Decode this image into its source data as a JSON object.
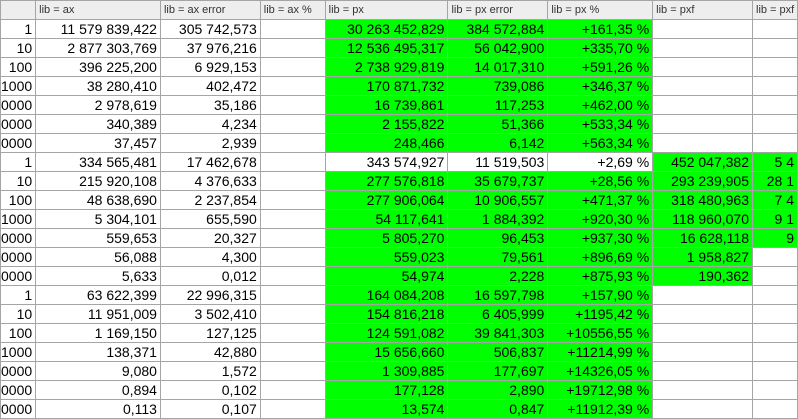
{
  "colors": {
    "highlight": "#00ff00",
    "grid_line": "#a5a5a5",
    "header_bg": "#eeeeee"
  },
  "columns": [
    "",
    "lib = ax",
    "lib = ax error",
    "lib = ax %",
    "lib = px",
    "lib = px error",
    "lib = px %",
    "lib = pxf",
    "lib = pxf"
  ],
  "rows": [
    {
      "cells": [
        "1",
        "11 579 839,422",
        "305 742,573",
        "",
        "30 263 452,829",
        "384 572,884",
        "+161,35 %",
        "",
        ""
      ],
      "green": [
        4,
        5,
        6
      ]
    },
    {
      "cells": [
        "10",
        "2 877 303,769",
        "37 976,216",
        "",
        "12 536 495,317",
        "56 042,900",
        "+335,70 %",
        "",
        ""
      ],
      "green": [
        4,
        5,
        6
      ]
    },
    {
      "cells": [
        "100",
        "396 225,200",
        "6 929,153",
        "",
        "2 738 929,819",
        "14 017,310",
        "+591,26 %",
        "",
        ""
      ],
      "green": [
        4,
        5,
        6
      ]
    },
    {
      "cells": [
        "1000",
        "38 280,410",
        "402,472",
        "",
        "170 871,732",
        "739,086",
        "+346,37 %",
        "",
        ""
      ],
      "green": [
        4,
        5,
        6
      ]
    },
    {
      "cells": [
        "0000",
        "2 978,619",
        "35,186",
        "",
        "16 739,861",
        "117,253",
        "+462,00 %",
        "",
        ""
      ],
      "green": [
        4,
        5,
        6
      ]
    },
    {
      "cells": [
        "0000",
        "340,389",
        "4,234",
        "",
        "2 155,822",
        "51,366",
        "+533,34 %",
        "",
        ""
      ],
      "green": [
        4,
        5,
        6
      ]
    },
    {
      "cells": [
        "0000",
        "37,457",
        "2,939",
        "",
        "248,466",
        "6,142",
        "+563,34 %",
        "",
        ""
      ],
      "green": [
        4,
        5,
        6
      ]
    },
    {
      "cells": [
        "1",
        "334 565,481",
        "17 462,678",
        "",
        "343 574,927",
        "11 519,503",
        "+2,69 %",
        "452 047,382",
        "5 4"
      ],
      "green": [
        7,
        8
      ]
    },
    {
      "cells": [
        "10",
        "215 920,108",
        "4 376,633",
        "",
        "277 576,818",
        "35 679,737",
        "+28,56 %",
        "293 239,905",
        "28 1"
      ],
      "green": [
        4,
        5,
        6,
        7,
        8
      ]
    },
    {
      "cells": [
        "100",
        "48 638,690",
        "2 237,854",
        "",
        "277 906,064",
        "10 906,557",
        "+471,37 %",
        "318 480,963",
        "7 4"
      ],
      "green": [
        4,
        5,
        6,
        7,
        8
      ]
    },
    {
      "cells": [
        "1000",
        "5 304,101",
        "655,590",
        "",
        "54 117,641",
        "1 884,392",
        "+920,30 %",
        "118 960,070",
        "9 1"
      ],
      "green": [
        4,
        5,
        6,
        7,
        8
      ]
    },
    {
      "cells": [
        "0000",
        "559,653",
        "20,327",
        "",
        "5 805,270",
        "96,453",
        "+937,30 %",
        "16 628,118",
        "9"
      ],
      "green": [
        4,
        5,
        6,
        7,
        8
      ]
    },
    {
      "cells": [
        "0000",
        "56,088",
        "4,300",
        "",
        "559,023",
        "79,561",
        "+896,69 %",
        "1 958,827",
        ""
      ],
      "green": [
        4,
        5,
        6,
        7
      ]
    },
    {
      "cells": [
        "0000",
        "5,633",
        "0,012",
        "",
        "54,974",
        "2,228",
        "+875,93 %",
        "190,362",
        ""
      ],
      "green": [
        4,
        5,
        6,
        7
      ]
    },
    {
      "cells": [
        "1",
        "63 622,399",
        "22 996,315",
        "",
        "164 084,208",
        "16 597,798",
        "+157,90 %",
        "",
        ""
      ],
      "green": [
        4,
        5,
        6
      ]
    },
    {
      "cells": [
        "10",
        "11 951,009",
        "3 502,410",
        "",
        "154 816,218",
        "6 405,999",
        "+1195,42 %",
        "",
        ""
      ],
      "green": [
        4,
        5,
        6
      ]
    },
    {
      "cells": [
        "100",
        "1 169,150",
        "127,125",
        "",
        "124 591,082",
        "39 841,303",
        "+10556,55 %",
        "",
        ""
      ],
      "green": [
        4,
        5,
        6
      ]
    },
    {
      "cells": [
        "1000",
        "138,371",
        "42,880",
        "",
        "15 656,660",
        "506,837",
        "+11214,99 %",
        "",
        ""
      ],
      "green": [
        4,
        5,
        6
      ]
    },
    {
      "cells": [
        "0000",
        "9,080",
        "1,572",
        "",
        "1 309,885",
        "177,697",
        "+14326,05 %",
        "",
        ""
      ],
      "green": [
        4,
        5,
        6
      ]
    },
    {
      "cells": [
        "0000",
        "0,894",
        "0,102",
        "",
        "177,128",
        "2,890",
        "+19712,98 %",
        "",
        ""
      ],
      "green": [
        4,
        5,
        6
      ]
    },
    {
      "cells": [
        "0000",
        "0,113",
        "0,107",
        "",
        "13,574",
        "0,847",
        "+11912,39 %",
        "",
        ""
      ],
      "green": [
        4,
        5,
        6
      ]
    }
  ]
}
